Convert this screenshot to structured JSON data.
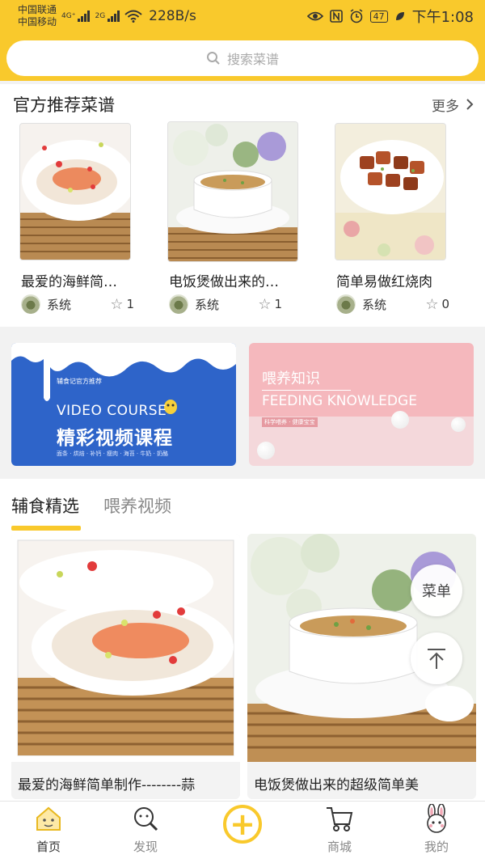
{
  "status_bar": {
    "carrier1": "中国联通",
    "carrier2": "中国移动",
    "net1": "4G⁺",
    "net2": "2G",
    "speed": "228B/s",
    "battery": "47",
    "time": "下午1:08"
  },
  "search": {
    "placeholder": "搜索菜谱"
  },
  "recommended": {
    "title": "官方推荐菜谱",
    "more": "更多",
    "cards": [
      {
        "title": "最爱的海鲜简…",
        "author": "系统",
        "stars": "1"
      },
      {
        "title": "电饭煲做出来的…",
        "author": "系统",
        "stars": "1"
      },
      {
        "title": "简单易做红烧肉",
        "author": "系统",
        "stars": "0"
      }
    ]
  },
  "banners": {
    "video": {
      "sub": "辅食记官方推荐",
      "en": "VIDEO COURSE",
      "cn": "精彩视频课程",
      "tags": "面条 · 烘焙 · 补钙 · 瘦肉 · 海苔 · 牛奶 · 奶酪"
    },
    "feeding": {
      "cn": "喂养知识",
      "en": "FEEDING KNOWLEDGE",
      "tag": "科学喂养 · 健康宝宝"
    }
  },
  "tabs": {
    "active": "辅食精选",
    "other": "喂养视频"
  },
  "feed": [
    {
      "title": "最爱的海鲜简单制作--------蒜"
    },
    {
      "title": "电饭煲做出来的超级简单美"
    }
  ],
  "floating": {
    "menu": "菜单"
  },
  "nav": {
    "home": "首页",
    "discover": "发现",
    "shop": "商城",
    "mine": "我的"
  },
  "colors": {
    "accent": "#f9c92c",
    "banner_blue": "#2e64c9",
    "banner_pink": "#f5b8bd"
  }
}
